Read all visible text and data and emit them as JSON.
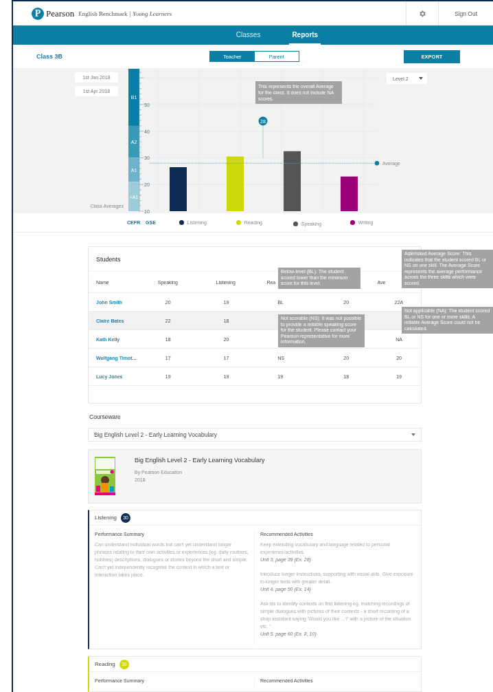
{
  "header": {
    "logo_mark": "P",
    "brand": "Pearson",
    "product": "English Benchmark",
    "separator": "|",
    "product_sub": "Young Learners",
    "sign_out": "Sign Out"
  },
  "nav_tabs": [
    {
      "label": "Classes",
      "selected": false
    },
    {
      "label": "Reports",
      "selected": true
    }
  ],
  "class_name": "Class 3B",
  "view_toggle": [
    {
      "label": "Teacher",
      "selected": true
    },
    {
      "label": "Parent",
      "selected": false
    }
  ],
  "export_button": "EXPORT",
  "date_filters": [
    "1st Jan 2018",
    "1st Apr 2018"
  ],
  "level_select": "Level 2",
  "cefr_bands": [
    "B1",
    "A2",
    "A1",
    "<A1"
  ],
  "chart_data": {
    "type": "bar",
    "ylabel": "Class Averages",
    "grid": true,
    "series": [
      {
        "name": "Listening",
        "color": "#0d2c54",
        "values": [
          26.5,
          null,
          null,
          null
        ]
      },
      {
        "name": "Reading",
        "color": "#cfd80a",
        "values": [
          null,
          30.5,
          null,
          null
        ]
      },
      {
        "name": "Speaking",
        "color": "#555555",
        "values": [
          null,
          null,
          32.5,
          null
        ]
      },
      {
        "name": "Writing",
        "color": "#9b0076",
        "values": [
          null,
          null,
          null,
          23
        ]
      }
    ],
    "ylim": [
      10,
      63.4
    ],
    "yticks": [
      10,
      20,
      30,
      40,
      50
    ],
    "annotations": [
      {
        "text": "28"
      }
    ]
  },
  "average_label": "Average",
  "chart_tooltip": "This represents the overall Average for the class. It does not include NA scores.",
  "scale_toggles": [
    "CEFR",
    "GSE"
  ],
  "students": {
    "title": "Students",
    "columns": [
      "Name",
      "Speaking",
      "Listening",
      "Rea",
      null,
      "Ave"
    ],
    "rows": [
      {
        "highlighted": false,
        "cells": [
          "John Smith",
          "20",
          "19",
          "BL",
          "20",
          "22A"
        ]
      },
      {
        "highlighted": true,
        "cells": [
          "Claire Bates",
          "22",
          "18",
          null,
          null,
          null
        ]
      },
      {
        "highlighted": false,
        "cells": [
          "Kath Kelly",
          "18",
          "20",
          null,
          null,
          "NA"
        ]
      },
      {
        "highlighted": false,
        "cells": [
          "Wolfgang Timot...",
          "17",
          "17",
          "NS",
          "20",
          "20"
        ]
      },
      {
        "highlighted": false,
        "cells": [
          "Lucy Jones",
          "19",
          "19",
          "19",
          "18",
          "19"
        ]
      }
    ],
    "tooltips": [
      "Below-level (BL): The student scored lower than the minimum score for this level.",
      "Asterisked Average Score: This indicates that the student scored BL or NS on one skill. The Average Score represents the average performance across the three skills which were scored.",
      "Not applicable (NA):  The student scored BL or NS for one or more skills. A reliable Average Score could not be calculated.",
      "Not scorable (NS): It was not possible to provide a reliable speaking score for the student. Please contact your Pearson representative for more information."
    ]
  },
  "courseware": {
    "label": "Courseware",
    "selected": "Big English Level 2 - Early Learning Vocabulary",
    "book": {
      "title": "Big English Level 2 - Early Learning Vocabulary",
      "author": "By Pearson Education",
      "year": "2018"
    }
  },
  "skills": [
    {
      "name": "Listening",
      "score": "30",
      "color": "#0d2c54",
      "summary_heading": "Performance Summary",
      "summary": "Can understand individual words but can't yet understand longer phrases relating to their own activities or experiences (eg. daily routines, hobbies) descriptions, dialogues or stories beyond the short and simple. Can't yet independently recognise the context in which a text or interaction takes place.",
      "activities_heading": "Recommended Activities",
      "activities": [
        {
          "text": "Keep extending vocabulary and language related to personal experience/activities.",
          "ref": "Unit 3, page 39 (Ex. 28)"
        },
        {
          "text": "Introduce longer instructions, supporting with visual aids. Give exposure to longer texts with greater detail.",
          "ref": "Unit 4, page 50 (Ex. 14)"
        },
        {
          "text": "Ask sts to identify contexts on first listening eg. matching recordings of simple dialogues with pictures of their contexts - a short recording of a shop assistant saying 'Would you like ...?' with a picture of the situation etc. \"",
          "ref": "Unit 5, page 60 (Ex. 8, 10)"
        }
      ]
    },
    {
      "name": "Reading",
      "score": "30",
      "color": "#cfd80a",
      "summary_heading": "Performance Summary",
      "activities_heading": "Recommended Activities"
    }
  ]
}
